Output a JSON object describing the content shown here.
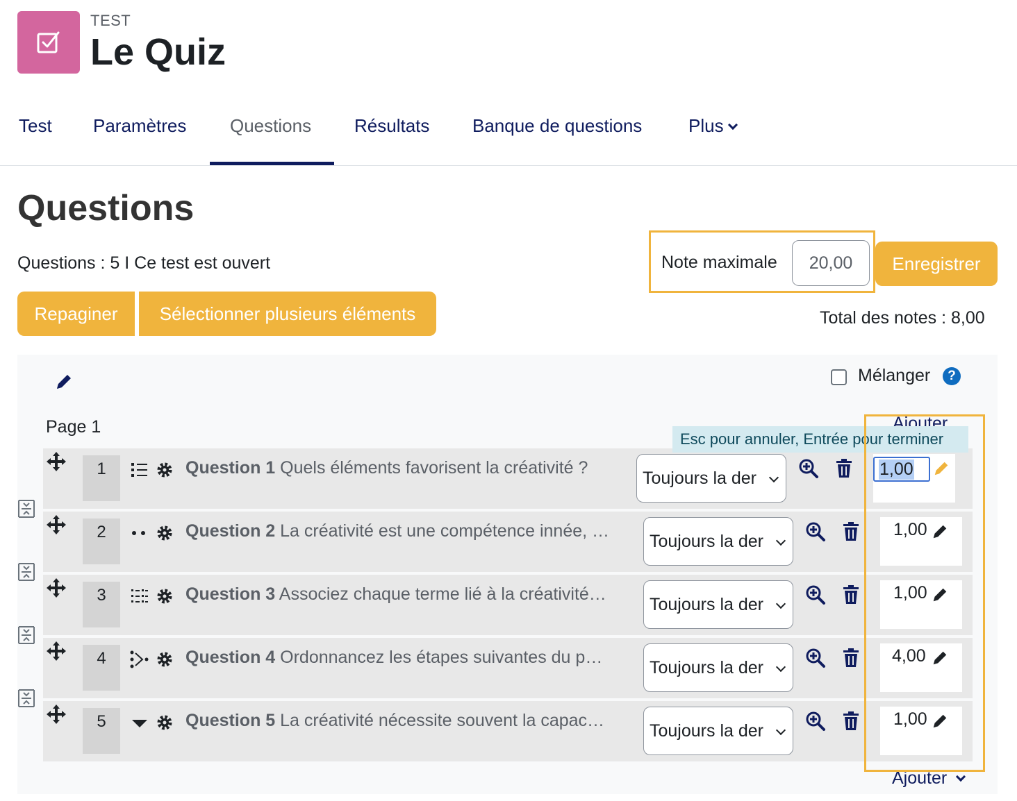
{
  "header": {
    "activity_type": "TEST",
    "title": "Le Quiz",
    "icon": "quiz-checkbox-icon",
    "icon_color": "#d3669e"
  },
  "nav": {
    "tabs": [
      {
        "label": "Test",
        "active": false
      },
      {
        "label": "Paramètres",
        "active": false
      },
      {
        "label": "Questions",
        "active": true
      },
      {
        "label": "Résultats",
        "active": false
      },
      {
        "label": "Banque de questions",
        "active": false
      },
      {
        "label": "Plus",
        "active": false
      }
    ]
  },
  "main": {
    "heading": "Questions",
    "status": "Questions : 5 I Ce test est ouvert",
    "max_grade_label": "Note maximale",
    "max_grade_value": "20,00",
    "save_label": "Enregistrer",
    "total_grades": "Total des notes : 8,00",
    "repaginate_label": "Repaginer",
    "select_multiple_label": "Sélectionner plusieurs éléments",
    "accent_color": "#f0b43d"
  },
  "section": {
    "shuffle_label": "Mélanger",
    "shuffle_checked": false,
    "page_label": "Page 1",
    "add_label": "Ajouter",
    "tooltip": "Esc pour annuler, Entrée pour terminer",
    "editing_grade": "1,00"
  },
  "questions": [
    {
      "number": "1",
      "title": "Question 1",
      "text": "Quels éléments favorisent la créativité ?",
      "type_icon": "multichoice-icon",
      "page_select": "Toujours la der",
      "grade": "1,00"
    },
    {
      "number": "2",
      "title": "Question 2",
      "text": "La créativité est une compétence innée, …",
      "type_icon": "truefalse-icon",
      "page_select": "Toujours la der",
      "grade": "1,00"
    },
    {
      "number": "3",
      "title": "Question 3",
      "text": "Associez chaque terme lié à la créativité…",
      "type_icon": "matching-icon",
      "page_select": "Toujours la der",
      "grade": "1,00"
    },
    {
      "number": "4",
      "title": "Question 4",
      "text": "Ordonnancez les étapes suivantes du p…",
      "type_icon": "ordering-icon",
      "page_select": "Toujours la der",
      "grade": "4,00"
    },
    {
      "number": "5",
      "title": "Question 5",
      "text": "La créativité nécessite souvent la capac…",
      "type_icon": "dropdown-icon",
      "page_select": "Toujours la der",
      "grade": "1,00"
    }
  ]
}
